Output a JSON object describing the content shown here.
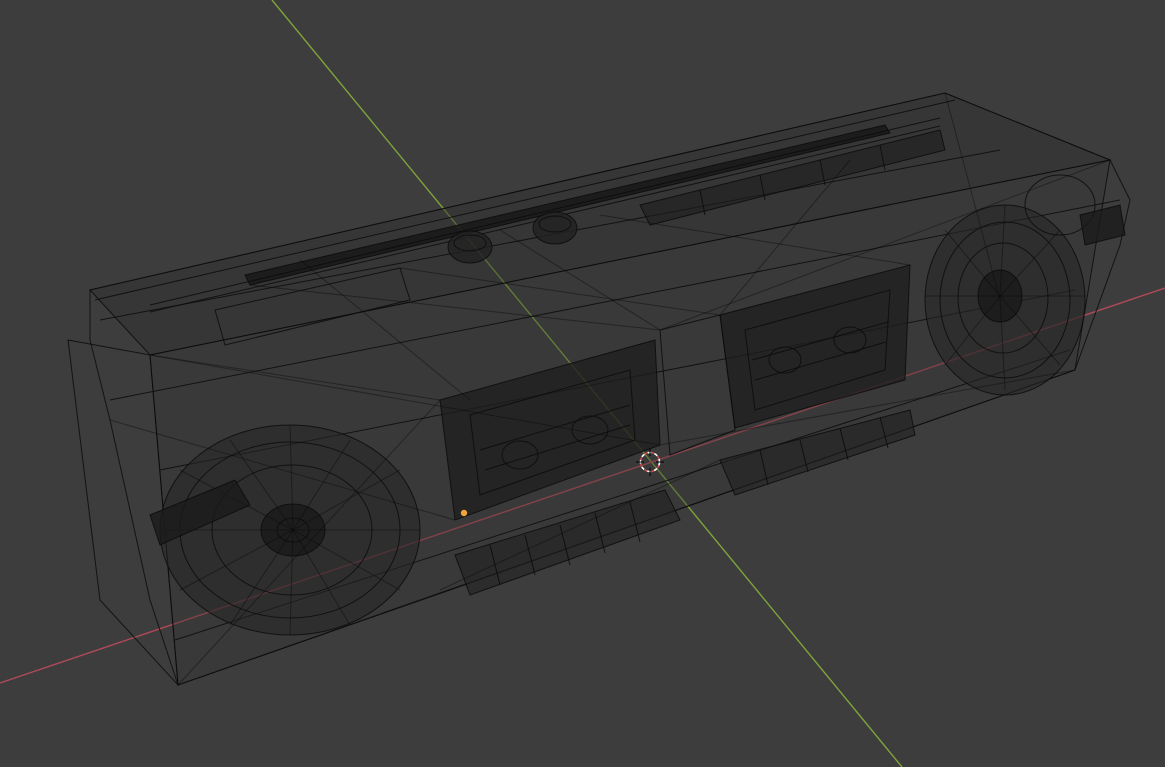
{
  "viewport": {
    "background": "#3d3d3d",
    "shading_mode": "wireframe"
  },
  "axes": {
    "x_axis_color": "#b04a56",
    "y_axis_color": "#7da43a"
  },
  "object": {
    "name": "boombox",
    "wire_color": "#0c0c0c",
    "selected_origin_color": "#f2a33a"
  },
  "cursor_3d": {
    "outer_color": "#ffffff",
    "inner_color": "#d04848"
  }
}
